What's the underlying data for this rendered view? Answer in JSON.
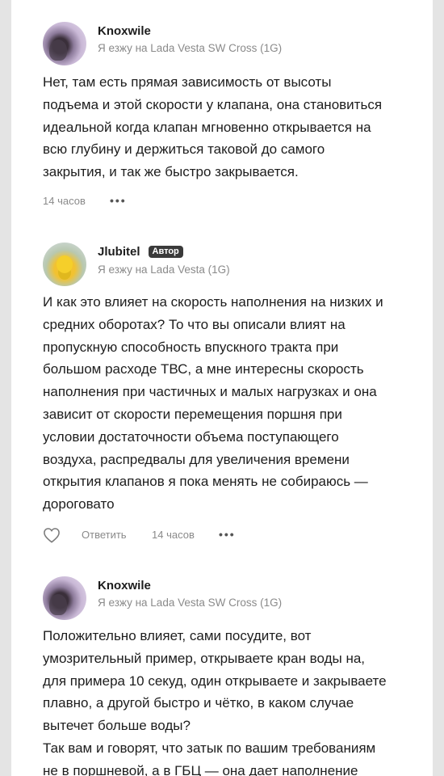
{
  "comments": [
    {
      "author": "Knoxwile",
      "badge": "",
      "car": "Я езжу на Lada Vesta SW Cross (1G)",
      "text": "Нет, там есть прямая зависимость от высоты\nподъема и этой скорости у клапана, она становиться\nидеальной когда клапан мгновенно открывается на\nвсю глубину и держиться таковой до самого\nзакрытия, и так же быстро закрывается.",
      "time": "14 часов",
      "reply": "",
      "more": "•••"
    },
    {
      "author": "Jlubitel",
      "badge": "Автор",
      "car": "Я езжу на Lada Vesta (1G)",
      "text": "И как это влияет на скорость наполнения на низких и\nсредних оборотах? То что вы описали влият на\nпропускную способность впускного тракта при\nбольшом расходе ТВС, а мне интересны скорость\nнаполнения при частичных и малых нагрузках и она\nзависит от скорости перемещения поршня при\nусловии достаточности объема поступающего\nвоздуха, распредвалы для увеличения времени\nоткрытия клапанов я пока менять не собираюсь —\nдороговато",
      "time": "14 часов",
      "reply": "Ответить",
      "more": "•••"
    },
    {
      "author": "Knoxwile",
      "badge": "",
      "car": "Я езжу на Lada Vesta SW Cross (1G)",
      "text": "Положительно влияет, сами посудите, вот\nумозрительный пример, открываете кран воды на,\nдля примера 10 секуд, один открываете и закрываете\nплавно, а другой быстро и чётко, в каком случае\nвытечет больше воды?\nТак вам и говорят, что затык по вашим требованиям\nне в поршневой, а в ГБЦ — она дает наполнение",
      "time": "",
      "reply": "",
      "more": ""
    }
  ]
}
